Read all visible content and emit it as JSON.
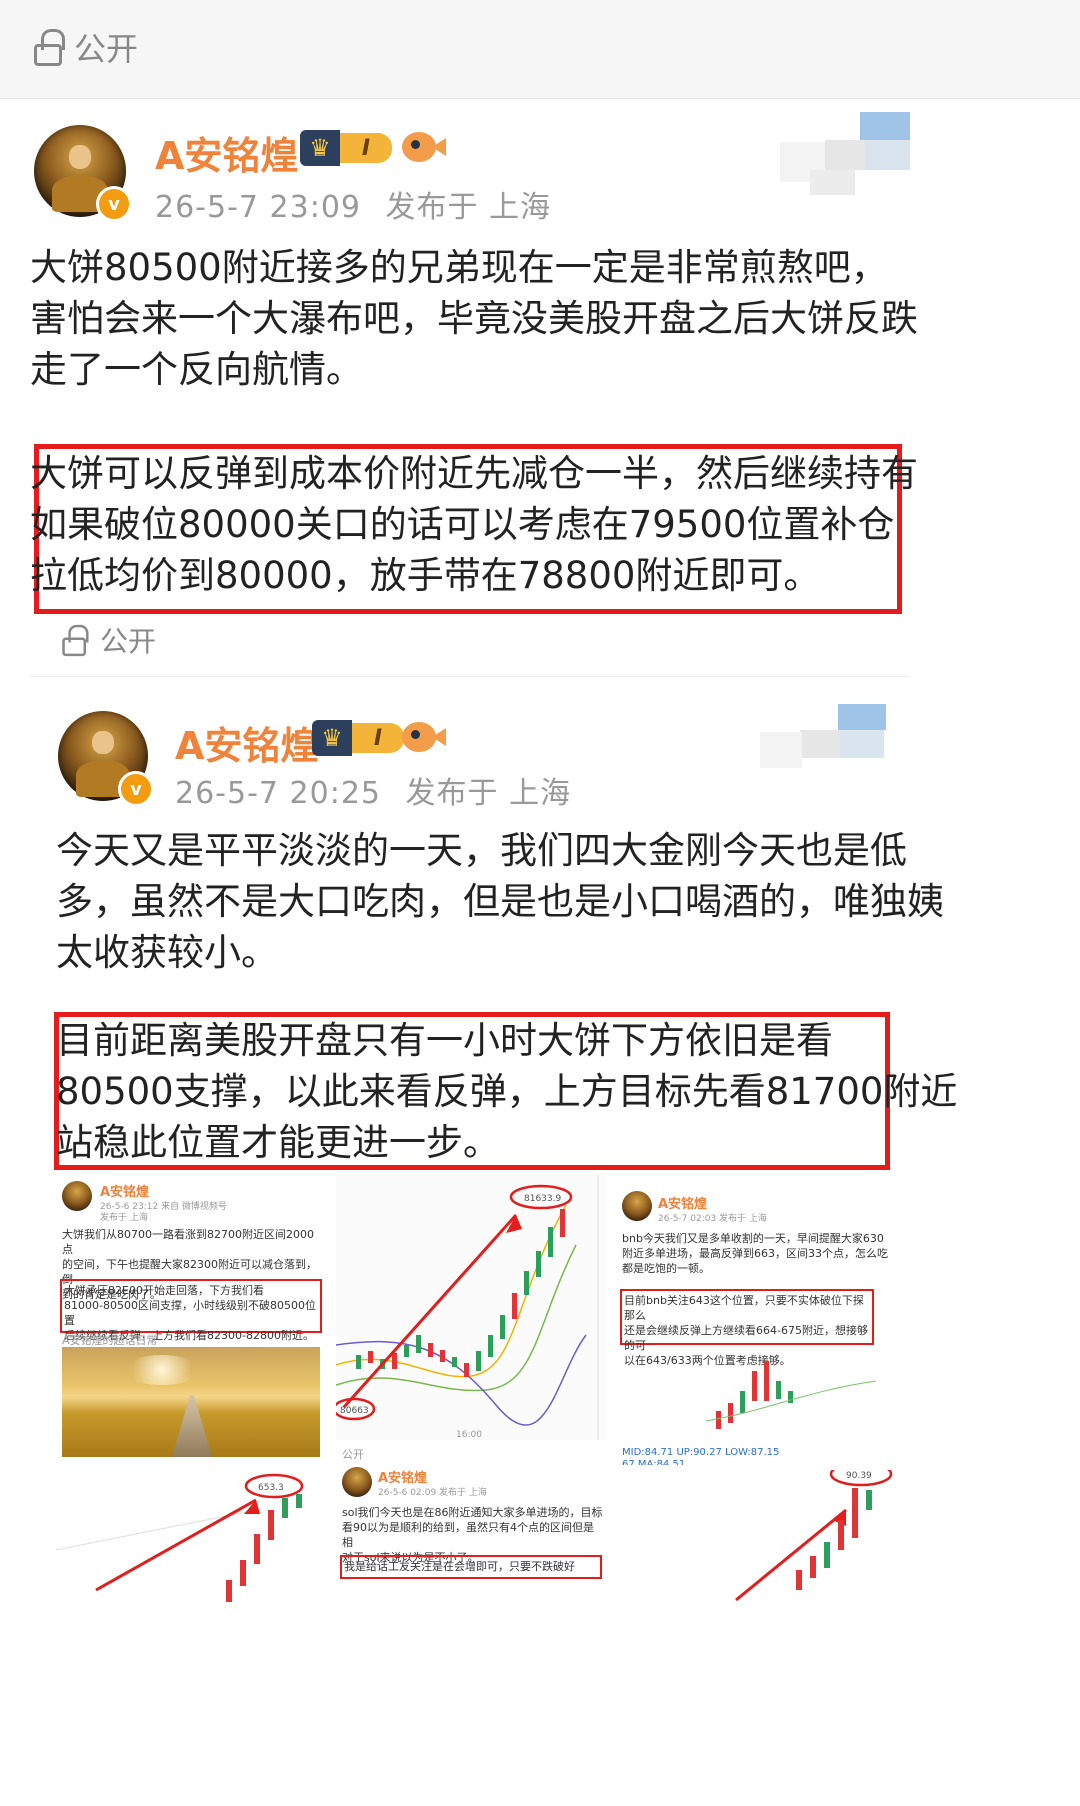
{
  "top_privacy": {
    "label": "公开"
  },
  "posts": [
    {
      "author": "A安铭煌",
      "badge": "I",
      "verified": "v",
      "time": "26-5-7 23:09",
      "location": "发布于 上海",
      "paragraph1": [
        "大饼80500附近接多的兄弟现在一定是非常煎熬吧，",
        "害怕会来一个大瀑布吧，毕竟没美股开盘之后大饼反跌",
        "走了一个反向航情。"
      ],
      "paragraph2": [
        "大饼可以反弹到成本价附近先减仓一半，然后继续持有",
        "如果破位80000关口的话可以考虑在79500位置补仓",
        "拉低均价到80000，放手带在78800附近即可。"
      ],
      "privacy": "公开"
    },
    {
      "author": "A安铭煌",
      "badge": "I",
      "verified": "v",
      "time": "26-5-7 20:25",
      "location": "发布于 上海",
      "paragraph1": [
        "今天又是平平淡淡的一天，我们四大金刚今天也是低",
        "多，虽然不是大口吃肉，但是也是小口喝酒的，唯独姨",
        "太收获较小。"
      ],
      "paragraph2": [
        "目前距离美股开盘只有一小时大饼下方依旧是看",
        "80500支撑，以此来看反弹，上方目标先看81700附近",
        "站稳此位置才能更进一步。"
      ]
    }
  ],
  "thumbnails": {
    "t1": {
      "name": "A安铭煌",
      "meta": "26-5-6 23:12 来自 微博视频号",
      "loc": "发布于 上海",
      "text": [
        "大饼我们从80700一路看涨到82700附近区间2000点",
        "的空间，下午也提醒大家82300附近可以减仓落到，倒",
        "到的肯定是吃肉了。"
      ],
      "boxed": [
        "大饼承压82E00开始走回落，下方我们看",
        "81000-80500区间支撑，小时线级别不破80500位置",
        "后续继续看反弹，上方我们看82300-82800附近。"
      ],
      "footer": "A安铭煌的超话日常"
    },
    "t2": {
      "peak": "81633.9",
      "low": "80663",
      "time": "16:00"
    },
    "t3": {
      "name": "A安铭煌",
      "meta": "26-5-7 02:03 发布于 上海",
      "text": [
        "bnb今天我们又是多单收割的一天，早间提醒大家630",
        "附近多单进场，最高反弹到663，区间33个点，怎么吃",
        "都是吃饱的一顿。"
      ],
      "boxed": [
        "目前bnb关注643这个位置，只要不实体破位下探那么",
        "还是会继续反弹上方继续看664-675附近，想接够的可",
        "以在643/633两个位置考虑接够。"
      ],
      "tag1": "MID:84.71  UP:90.27  LOW:87.15",
      "tag2": "67  MA:84.51"
    },
    "t4": {
      "peak": "653.3"
    },
    "t5": {
      "privacy": "公开",
      "name": "A安铭煌",
      "meta": "26-5-6 02:09 发布于 上海",
      "text": [
        "sol我们今天也是在86附近通知大家多单进场的，目标",
        "看90以为是顺利的给到，虽然只有4个点的区间但是相",
        "对于sol来说以为是不小了。"
      ],
      "boxed": "我是给话工友关注是在会增即可，只要不跌破好"
    },
    "t6": {
      "peak": "90.39"
    }
  }
}
